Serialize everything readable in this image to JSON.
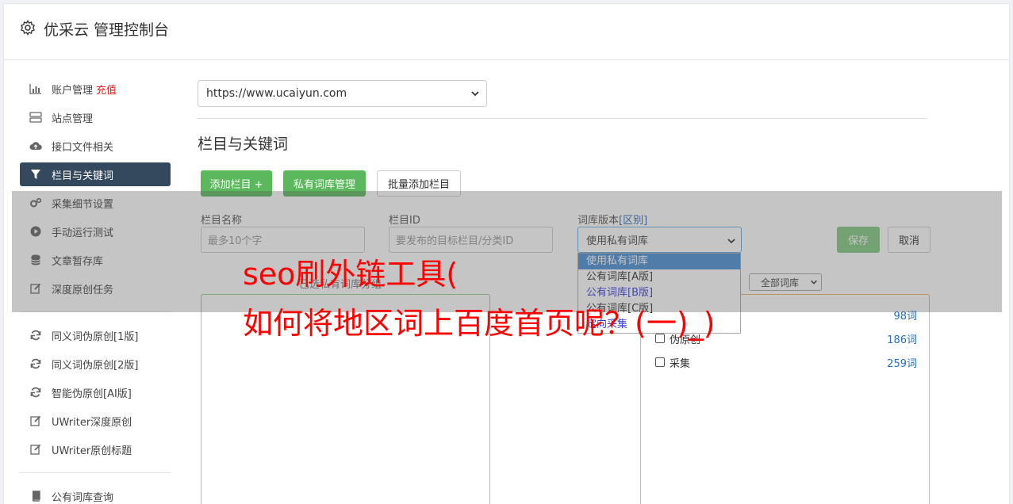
{
  "header": {
    "title": "优采云 管理控制台"
  },
  "sidebar": {
    "items": [
      {
        "label": "账户管理",
        "extra": "充值",
        "icon": "bar-chart-icon"
      },
      {
        "label": "站点管理",
        "icon": "server-icon"
      },
      {
        "label": "接口文件相关",
        "icon": "cloud-upload-icon"
      },
      {
        "label": "栏目与关键词",
        "icon": "filter-icon",
        "active": true
      },
      {
        "label": "采集细节设置",
        "icon": "gears-icon"
      },
      {
        "label": "手动运行测试",
        "icon": "play-circle-icon"
      },
      {
        "label": "文章暂存库",
        "icon": "database-icon"
      },
      {
        "label": "深度原创任务",
        "icon": "edit-icon"
      }
    ],
    "items2": [
      {
        "label": "同义词伪原创[1版]",
        "icon": "refresh-icon"
      },
      {
        "label": "同义词伪原创[2版]",
        "icon": "refresh-icon"
      },
      {
        "label": "智能伪原创[AI版]",
        "icon": "refresh-icon"
      },
      {
        "label": "UWriter深度原创",
        "icon": "edit-icon"
      },
      {
        "label": "UWriter原创标题",
        "icon": "edit-icon"
      }
    ],
    "items3": [
      {
        "label": "公有词库查询",
        "icon": "book-icon"
      }
    ]
  },
  "main": {
    "site_select": "https://www.ucaiyun.com",
    "section_title": "栏目与关键词",
    "buttons": {
      "add_column": "添加栏目 +",
      "private_lib": "私有词库管理",
      "batch_add": "批量添加栏目"
    },
    "form": {
      "name_label": "栏目名称",
      "name_placeholder": "最多10个字",
      "id_label": "栏目ID",
      "id_placeholder": "要发布的目标栏目/分类ID",
      "lib_label": "词库版本",
      "lib_link": "[区别]",
      "lib_value": "使用私有词库",
      "save": "保存",
      "cancel": "取消"
    },
    "dropdown_options": [
      "使用私有词库",
      "公有词库[A版]",
      "公有词库[B版]",
      "公有词库[C版]",
      "定向采集"
    ],
    "faint_text": "已选私有词库分组",
    "all_lib": "全部词库",
    "libraries": [
      {
        "name": "",
        "count": "98词"
      },
      {
        "name": "伪原创",
        "count": "186词"
      },
      {
        "name": "采集",
        "count": "259词"
      }
    ]
  },
  "overlay_text": {
    "line1": "seo刷外链工具(",
    "line2": "如何将地区词上百度首页呢？(一)_)"
  },
  "colors": {
    "active_nav": "#34495e",
    "green": "#5cb85c",
    "overlay_red": "#ff0000",
    "link_blue": "#2a6fba"
  }
}
